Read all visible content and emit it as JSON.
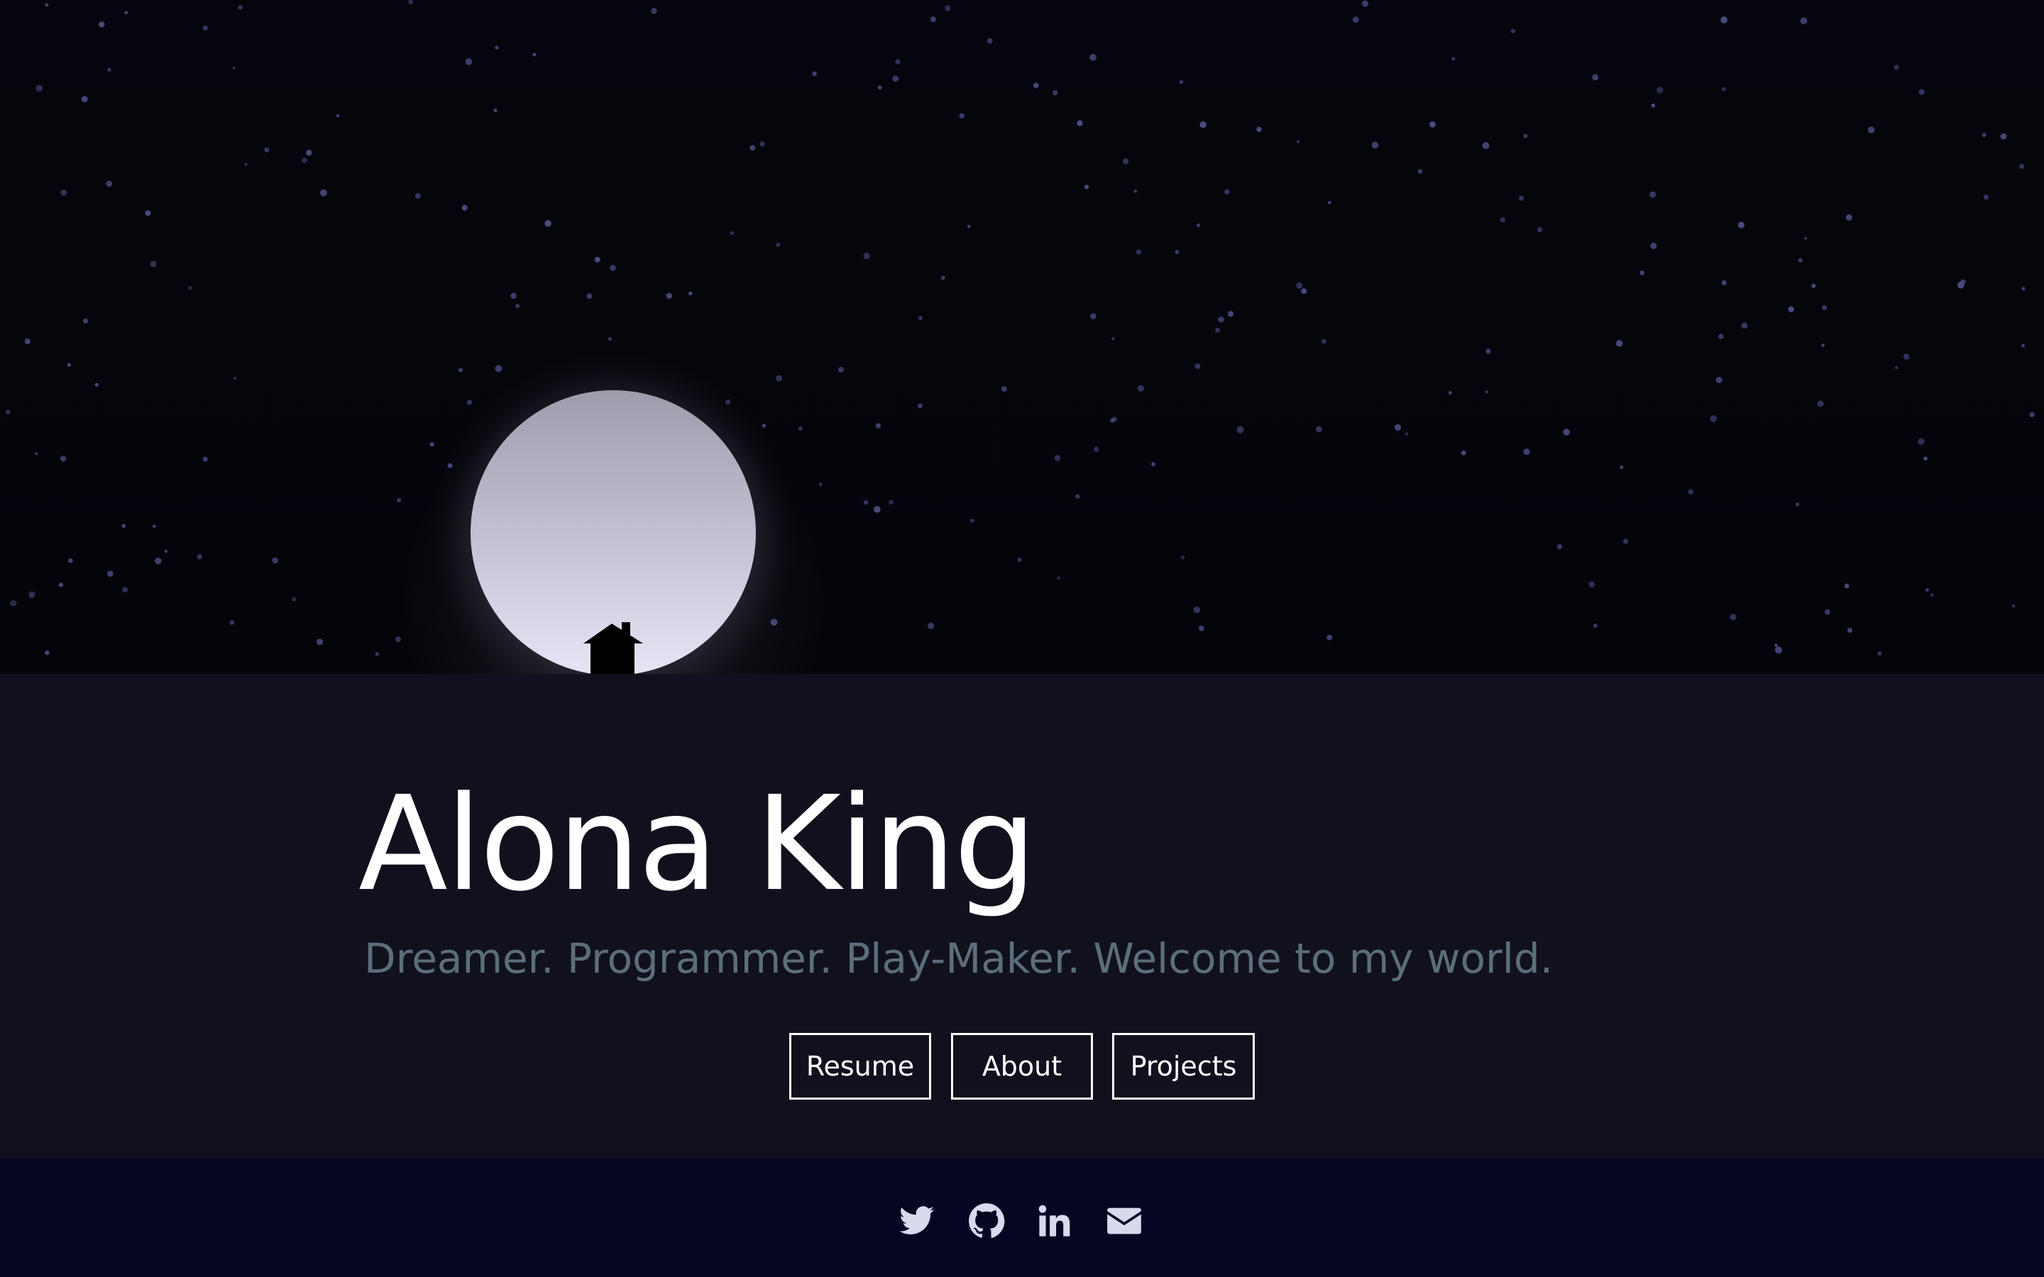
{
  "hero": {
    "name": "Alona King",
    "tagline": "Dreamer. Programmer. Play-Maker. Welcome to my world."
  },
  "nav_buttons": {
    "resume": "Resume",
    "about": "About",
    "projects": "Projects"
  },
  "social_links": [
    {
      "icon": "twitter-icon"
    },
    {
      "icon": "github-icon"
    },
    {
      "icon": "linkedin-icon"
    },
    {
      "icon": "mail-icon"
    }
  ],
  "colors": {
    "sky": "#05060d",
    "content_bg": "#11111e",
    "footer_bg": "#050622",
    "tagline": "#5c6e7a",
    "star": "#4a4a80",
    "moon_top": "#9c9cab",
    "moon_bottom": "#e6e5f6",
    "icon": "#d9d9ee"
  }
}
